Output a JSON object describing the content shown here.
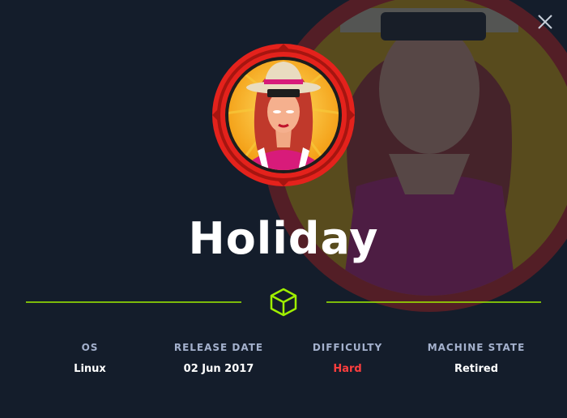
{
  "machine": {
    "name": "Holiday"
  },
  "stats": [
    {
      "label": "OS",
      "value": "Linux"
    },
    {
      "label": "RELEASE DATE",
      "value": "02 Jun 2017"
    },
    {
      "label": "DIFFICULTY",
      "value": "Hard"
    },
    {
      "label": "MACHINE STATE",
      "value": "Retired"
    }
  ],
  "colors": {
    "background": "#141d2b",
    "accent": "#9fef00",
    "difficulty_hard": "#ff3e3e",
    "label": "#a4b1cd",
    "avatar_ring": "#e4221c"
  },
  "icons": {
    "close": "close-icon",
    "divider": "cube-icon"
  }
}
